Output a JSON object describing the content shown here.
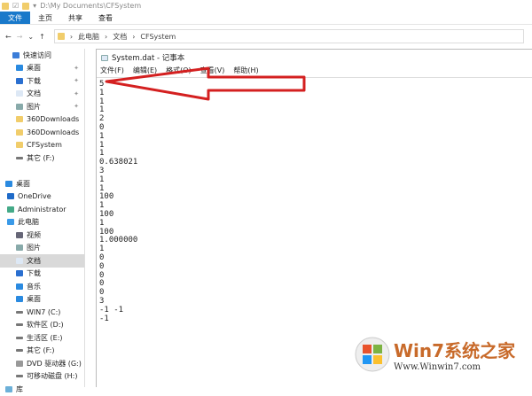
{
  "window": {
    "path": "D:\\My Documents\\CFSystem"
  },
  "ribbon": {
    "tabs": [
      "文件",
      "主页",
      "共享",
      "查看"
    ]
  },
  "address": {
    "crumbs": [
      "此电脑",
      "文档",
      "CFSystem"
    ]
  },
  "sidebar": {
    "items": [
      {
        "label": "快速访问",
        "icon": "star"
      },
      {
        "label": "桌面",
        "icon": "desktop",
        "pin": true
      },
      {
        "label": "下载",
        "icon": "download",
        "pin": true
      },
      {
        "label": "文档",
        "icon": "document",
        "pin": true
      },
      {
        "label": "图片",
        "icon": "picture",
        "pin": true
      },
      {
        "label": "360Downloads",
        "icon": "folder"
      },
      {
        "label": "360Downloads",
        "icon": "folder"
      },
      {
        "label": "CFSystem",
        "icon": "folder"
      },
      {
        "label": "其它 (F:)",
        "icon": "drive"
      },
      {
        "label": "",
        "icon": ""
      },
      {
        "label": "桌面",
        "icon": "desktop"
      },
      {
        "label": "OneDrive",
        "icon": "cloud"
      },
      {
        "label": "Administrator",
        "icon": "user"
      },
      {
        "label": "此电脑",
        "icon": "pc"
      },
      {
        "label": "视频",
        "icon": "video"
      },
      {
        "label": "图片",
        "icon": "picture"
      },
      {
        "label": "文档",
        "icon": "document",
        "selected": true
      },
      {
        "label": "下载",
        "icon": "download"
      },
      {
        "label": "音乐",
        "icon": "music"
      },
      {
        "label": "桌面",
        "icon": "desktop"
      },
      {
        "label": "WIN7 (C:)",
        "icon": "drive"
      },
      {
        "label": "软件区 (D:)",
        "icon": "drive"
      },
      {
        "label": "生活区 (E:)",
        "icon": "drive"
      },
      {
        "label": "其它 (F:)",
        "icon": "drive"
      },
      {
        "label": "DVD 驱动器 (G:)",
        "icon": "dvd"
      },
      {
        "label": "可移动磁盘 (H:)",
        "icon": "drive"
      },
      {
        "label": "库",
        "icon": "library"
      }
    ]
  },
  "notepad": {
    "title": "System.dat - 记事本",
    "menu": [
      "文件(F)",
      "编辑(E)",
      "格式(O)",
      "查看(V)",
      "帮助(H)"
    ],
    "lines": [
      "5",
      "1",
      "1",
      "1",
      "2",
      "0",
      "1",
      "1",
      "1",
      "0.638021",
      "3",
      "1",
      "1",
      "100",
      "1",
      "100",
      "1",
      "100",
      "1.000000",
      "1",
      "0",
      "0",
      "0",
      "0",
      "0",
      "3",
      "-1 -1",
      "-1"
    ]
  },
  "annotation": {
    "color": "#d42020"
  },
  "watermark": {
    "brand": "Win7系统之家",
    "url": "Www.Winwin7.com"
  }
}
